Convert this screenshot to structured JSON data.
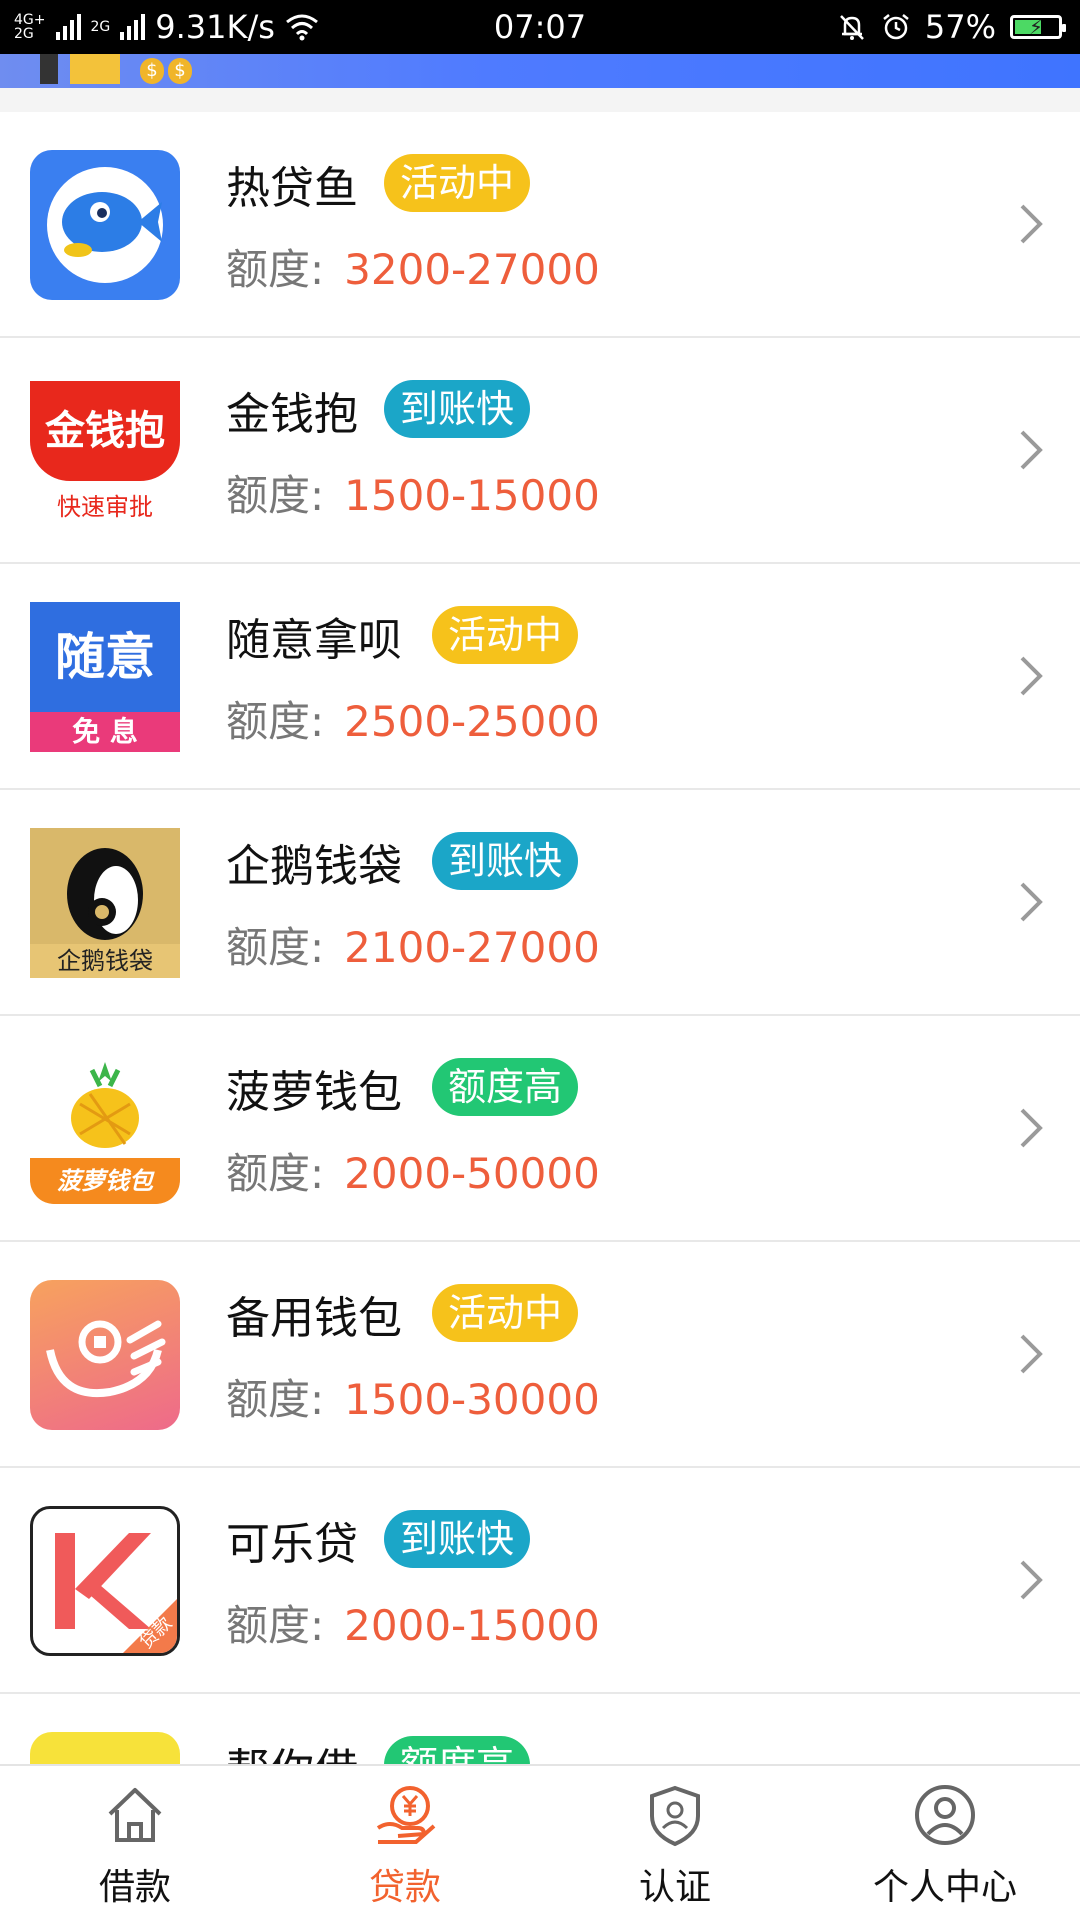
{
  "status_bar": {
    "network_top": "4G+",
    "network_bottom": "2G",
    "network_2g": "2G",
    "speed": "9.31K/s",
    "time": "07:07",
    "battery": "57%"
  },
  "loans": [
    {
      "name": "热贷鱼",
      "badge": "活动中",
      "badge_color": "yellow",
      "amount_label": "额度:",
      "amount": "3200-27000",
      "icon": "fish-icon"
    },
    {
      "name": "金钱抱",
      "badge": "到账快",
      "badge_color": "teal",
      "amount_label": "额度:",
      "amount": "1500-15000",
      "icon": "jinqianbao-logo-icon",
      "logo_text": "金钱抱",
      "logo_sub": "快速审批"
    },
    {
      "name": "随意拿呗",
      "badge": "活动中",
      "badge_color": "yellow",
      "amount_label": "额度:",
      "amount": "2500-25000",
      "icon": "suiyi-logo-icon",
      "logo_text": "随意",
      "logo_sub": "免 息"
    },
    {
      "name": "企鹅钱袋",
      "badge": "到账快",
      "badge_color": "teal",
      "amount_label": "额度:",
      "amount": "2100-27000",
      "icon": "penguin-icon",
      "logo_sub": "企鹅钱袋"
    },
    {
      "name": "菠萝钱包",
      "badge": "额度高",
      "badge_color": "green",
      "amount_label": "额度:",
      "amount": "2000-50000",
      "icon": "pineapple-icon",
      "logo_sub": "菠萝钱包"
    },
    {
      "name": "备用钱包",
      "badge": "活动中",
      "badge_color": "yellow",
      "amount_label": "额度:",
      "amount": "1500-30000",
      "icon": "hand-coin-icon"
    },
    {
      "name": "可乐贷",
      "badge": "到账快",
      "badge_color": "teal",
      "amount_label": "额度:",
      "amount": "2000-15000",
      "icon": "kele-logo-icon",
      "logo_sub": "贷款"
    }
  ],
  "partial_loan": {
    "name": "帮你借",
    "badge": "额度高"
  },
  "bottom_nav": [
    {
      "label": "借款",
      "icon": "home-icon",
      "active": false
    },
    {
      "label": "贷款",
      "icon": "loan-yen-icon",
      "active": true
    },
    {
      "label": "认证",
      "icon": "shield-check-icon",
      "active": false
    },
    {
      "label": "个人中心",
      "icon": "user-circle-icon",
      "active": false
    }
  ],
  "colors": {
    "accent": "#f2622e",
    "amount": "#ee5e3c",
    "badge_yellow": "#f6c21b",
    "badge_teal": "#1ba6c8",
    "badge_green": "#22c774",
    "header_blue": "#4f7bff"
  }
}
